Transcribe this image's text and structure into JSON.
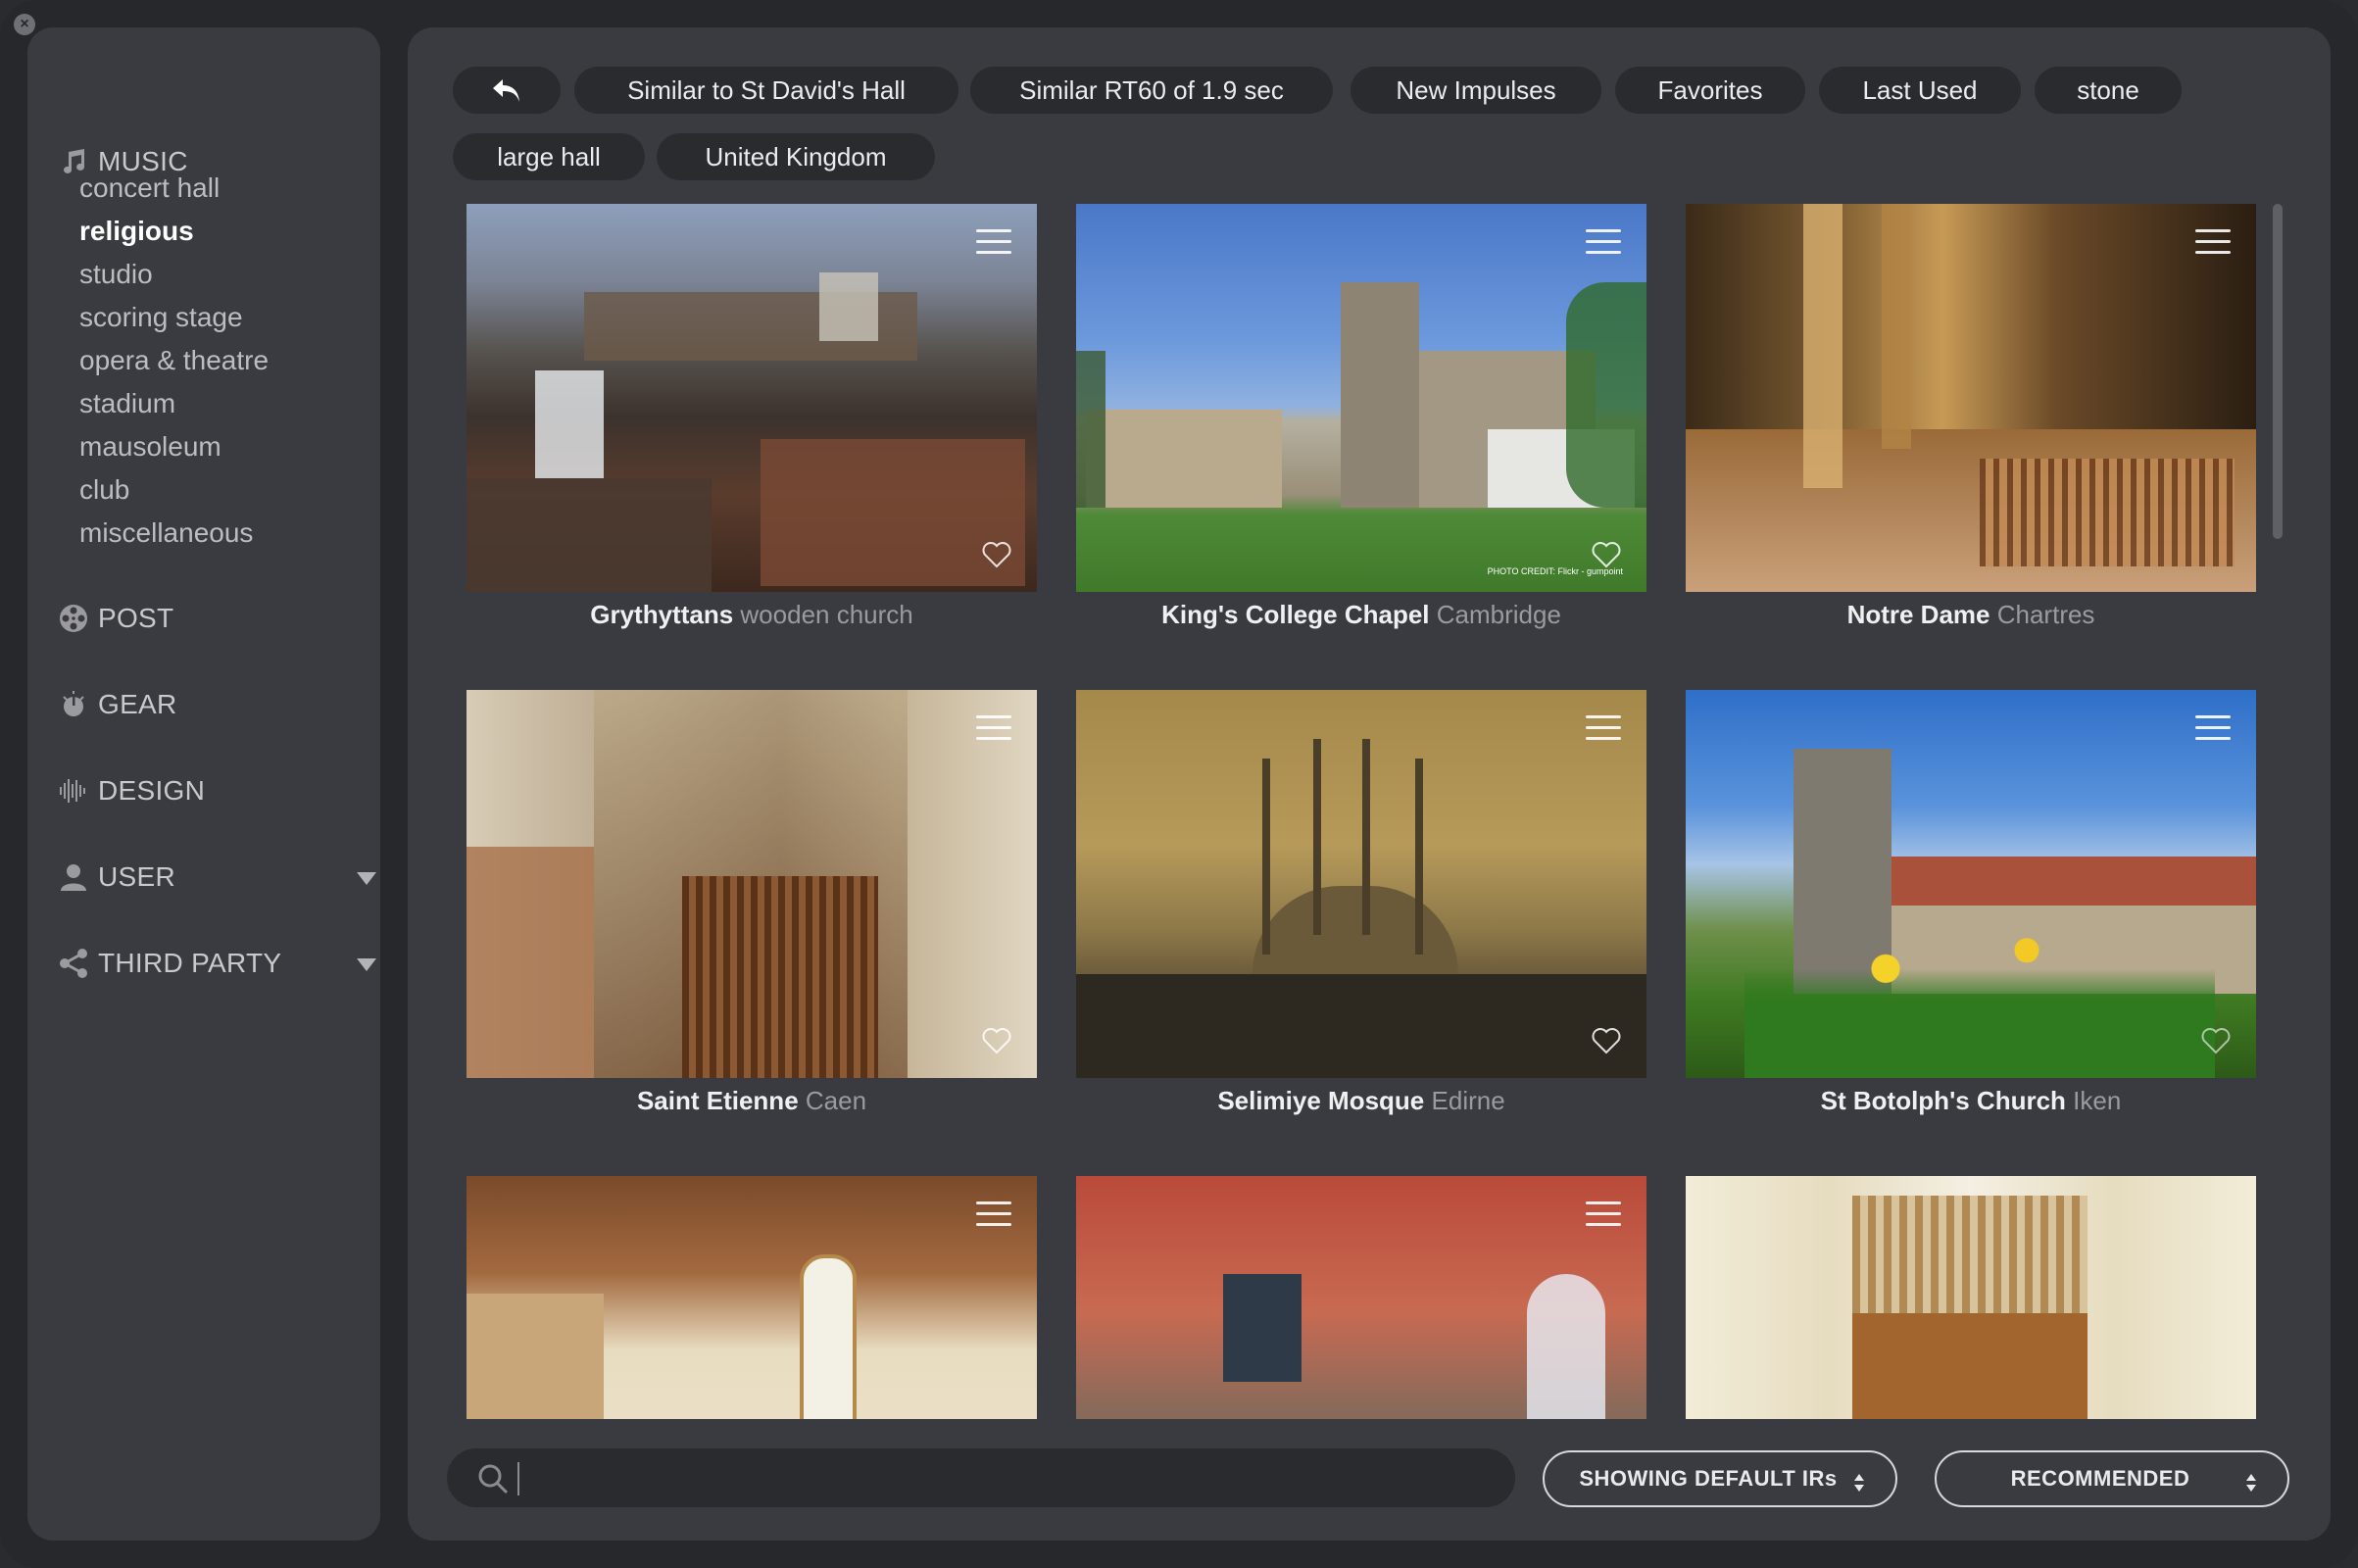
{
  "sidebar": {
    "sections": [
      {
        "label": "MUSIC",
        "icon": "music-note-icon"
      },
      {
        "label": "POST",
        "icon": "film-reel-icon"
      },
      {
        "label": "GEAR",
        "icon": "knob-icon"
      },
      {
        "label": "DESIGN",
        "icon": "waveform-icon"
      },
      {
        "label": "USER",
        "icon": "user-icon",
        "expandable": true
      },
      {
        "label": "THIRD PARTY",
        "icon": "share-icon",
        "expandable": true
      }
    ],
    "music_items": [
      {
        "label": "concert hall"
      },
      {
        "label": "religious",
        "selected": true
      },
      {
        "label": "studio"
      },
      {
        "label": "scoring stage"
      },
      {
        "label": "opera & theatre"
      },
      {
        "label": "stadium"
      },
      {
        "label": "mausoleum"
      },
      {
        "label": "club"
      },
      {
        "label": "miscellaneous"
      }
    ]
  },
  "filters": {
    "back_icon": "back-arrow-icon",
    "chips": [
      "Similar to St David's Hall",
      "Similar RT60 of 1.9 sec",
      "New Impulses",
      "Favorites",
      "Last Used",
      "stone",
      "large hall",
      "United Kingdom"
    ]
  },
  "cards": [
    {
      "name": "Grythyttans",
      "location": "wooden church"
    },
    {
      "name": "King's College Chapel",
      "location": "Cambridge",
      "credit": "PHOTO CREDIT: Flickr - gumpoint"
    },
    {
      "name": "Notre Dame",
      "location": "Chartres"
    },
    {
      "name": "Saint Etienne",
      "location": "Caen"
    },
    {
      "name": "Selimiye Mosque",
      "location": "Edirne"
    },
    {
      "name": "St Botolph's Church",
      "location": "Iken"
    },
    {
      "name": "",
      "location": ""
    },
    {
      "name": "",
      "location": ""
    },
    {
      "name": "",
      "location": ""
    }
  ],
  "bottom_bar": {
    "search_placeholder": "",
    "ir_filter": "SHOWING DEFAULT IRs",
    "sort": "RECOMMENDED"
  },
  "colors": {
    "background": "#27282c",
    "panel": "#3a3b40",
    "chip": "#2a2b2f",
    "text_active": "#ffffff",
    "text_muted": "#9a9a9f"
  }
}
